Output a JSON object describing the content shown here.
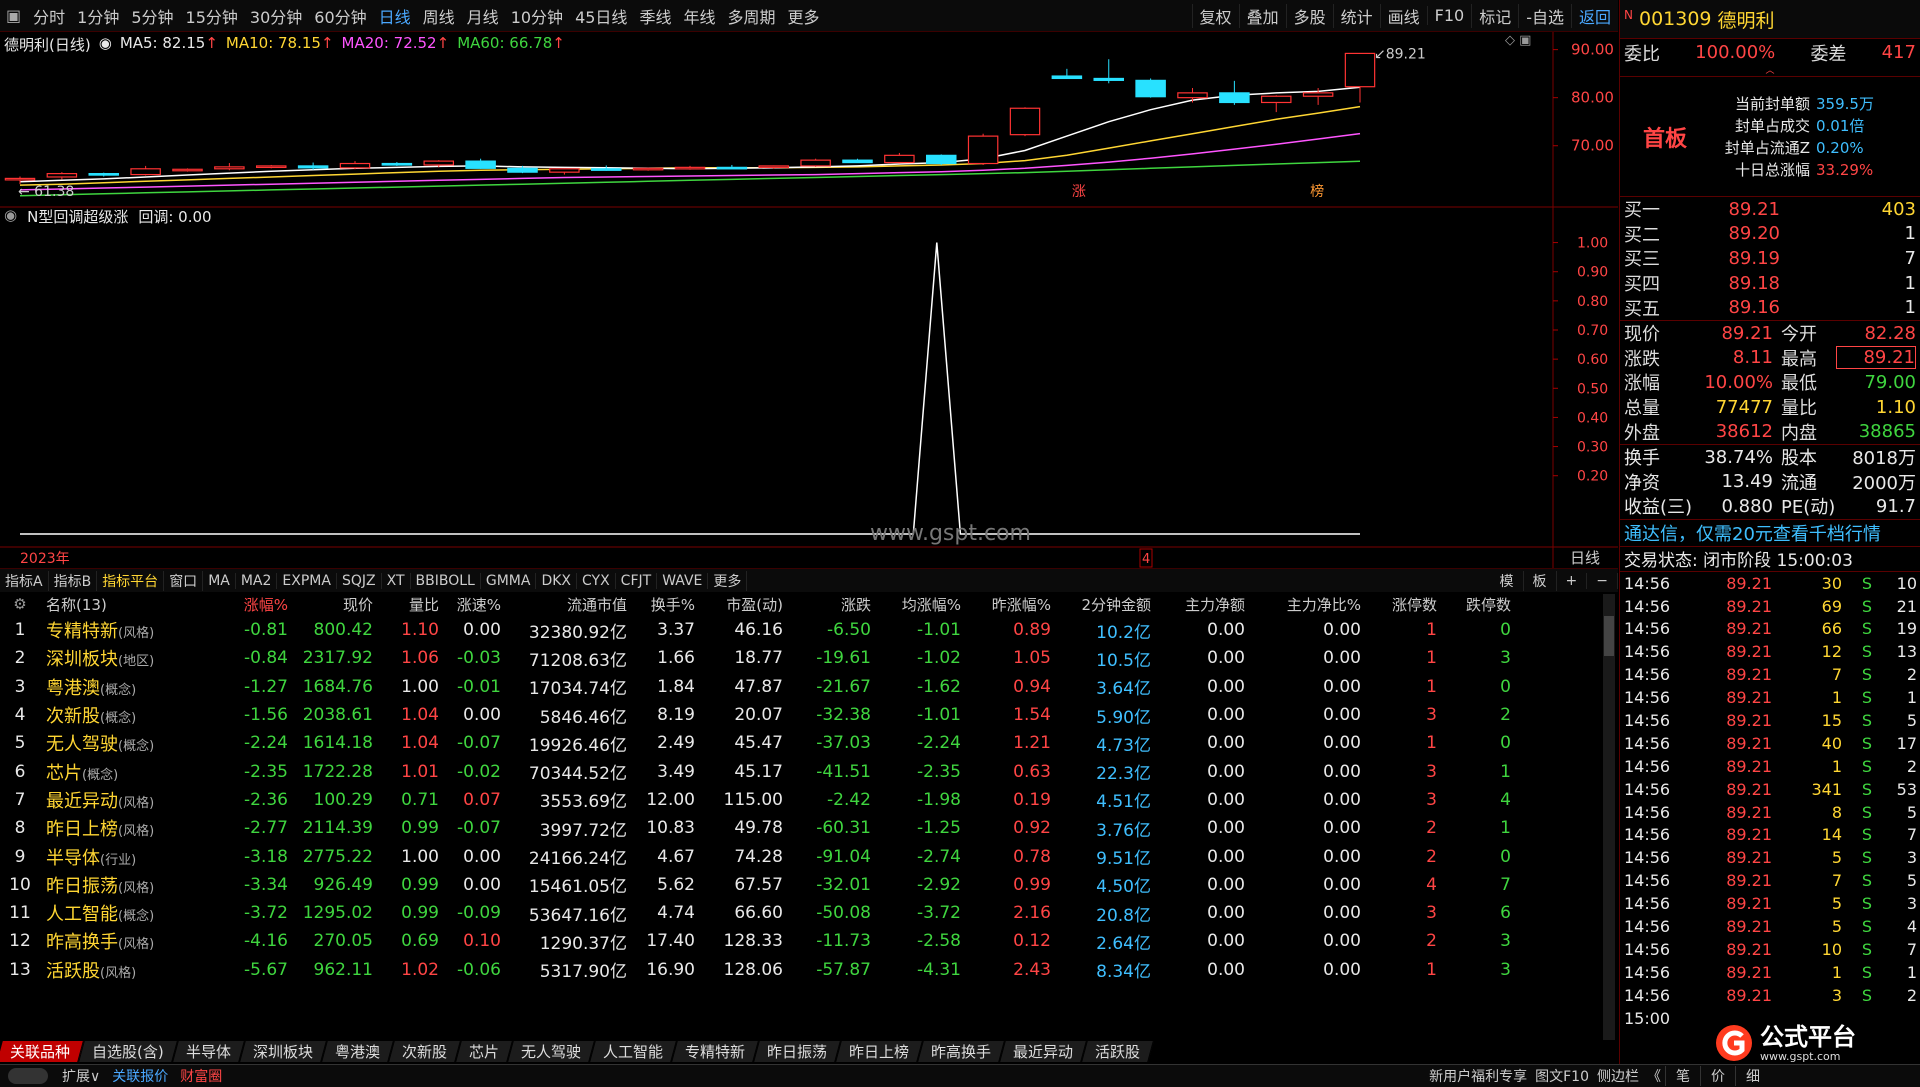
{
  "periods": [
    "分时",
    "1分钟",
    "5分钟",
    "15分钟",
    "30分钟",
    "60分钟",
    "日线",
    "周线",
    "月线",
    "10分钟",
    "45日线",
    "季线",
    "年线",
    "多周期",
    "更多"
  ],
  "active_period": "日线",
  "tools": [
    "复权",
    "叠加",
    "多股",
    "统计",
    "画线",
    "F10",
    "标记",
    "-自选",
    "返回"
  ],
  "kinfo": {
    "name": "德明利(日线)",
    "ma5": "MA5: 82.15",
    "ma10": "MA10: 78.15",
    "ma20": "MA20: 72.52",
    "ma60": "MA60: 66.78",
    "arrow": "↑"
  },
  "price_axis": [
    "90.00",
    "80.00",
    "70.00"
  ],
  "high_label": "89.21",
  "low_label": "61.38",
  "markers": {
    "zhang": "涨",
    "bang": "榜"
  },
  "indicator": {
    "title": "N型回调超级涨",
    "field": "回调: 0.00",
    "axis": [
      "1.00",
      "0.90",
      "0.80",
      "0.70",
      "0.60",
      "0.50",
      "0.40",
      "0.30",
      "0.20"
    ],
    "year": "2023年",
    "cursor_val": "4",
    "period_label": "日线",
    "watermark": "www.gspt.com"
  },
  "ind_tabs": [
    "指标A",
    "指标B",
    "指标平台",
    "窗口",
    "MA",
    "MA2",
    "EXPMA",
    "SQJZ",
    "XT",
    "BBIBOLL",
    "GMMA",
    "DKX",
    "CYX",
    "CFJT",
    "WAVE",
    "更多"
  ],
  "ind_tabs_active": "指标平台",
  "ind_tabs_right": [
    "模",
    "板",
    "+",
    "−"
  ],
  "table": {
    "headers": [
      "",
      "名称(13)",
      "涨幅%",
      "现价",
      "量比",
      "涨速%",
      "流通市值",
      "换手%",
      "市盈(动)",
      "涨跌",
      "均涨幅%",
      "昨涨幅%",
      "2分钟金额",
      "主力净额",
      "主力净比%",
      "涨停数",
      "跌停数"
    ],
    "rows": [
      [
        "1",
        "专精特新",
        "(风格)",
        "-0.81",
        "800.42",
        "1.10",
        "0.00",
        "32380.92亿",
        "3.37",
        "46.16",
        "-6.50",
        "-1.01",
        "0.89",
        "10.2亿",
        "0.00",
        "0.00",
        "1",
        "0"
      ],
      [
        "2",
        "深圳板块",
        "(地区)",
        "-0.84",
        "2317.92",
        "1.06",
        "-0.03",
        "71208.63亿",
        "1.66",
        "18.77",
        "-19.61",
        "-1.02",
        "1.05",
        "10.5亿",
        "0.00",
        "0.00",
        "1",
        "3"
      ],
      [
        "3",
        "粤港澳",
        "(概念)",
        "-1.27",
        "1684.76",
        "1.00",
        "-0.01",
        "17034.74亿",
        "1.84",
        "47.87",
        "-21.67",
        "-1.62",
        "0.94",
        "3.64亿",
        "0.00",
        "0.00",
        "1",
        "0"
      ],
      [
        "4",
        "次新股",
        "(概念)",
        "-1.56",
        "2038.61",
        "1.04",
        "0.00",
        "5846.46亿",
        "8.19",
        "20.07",
        "-32.38",
        "-1.01",
        "1.54",
        "5.90亿",
        "0.00",
        "0.00",
        "3",
        "2"
      ],
      [
        "5",
        "无人驾驶",
        "(概念)",
        "-2.24",
        "1614.18",
        "1.04",
        "-0.07",
        "19926.46亿",
        "2.49",
        "45.47",
        "-37.03",
        "-2.24",
        "1.21",
        "4.73亿",
        "0.00",
        "0.00",
        "1",
        "0"
      ],
      [
        "6",
        "芯片",
        "(概念)",
        "-2.35",
        "1722.28",
        "1.01",
        "-0.02",
        "70344.52亿",
        "3.49",
        "45.17",
        "-41.51",
        "-2.35",
        "0.63",
        "22.3亿",
        "0.00",
        "0.00",
        "3",
        "1"
      ],
      [
        "7",
        "最近异动",
        "(风格)",
        "-2.36",
        "100.29",
        "0.71",
        "0.07",
        "3553.69亿",
        "12.00",
        "115.00",
        "-2.42",
        "-1.98",
        "0.19",
        "4.51亿",
        "0.00",
        "0.00",
        "3",
        "4"
      ],
      [
        "8",
        "昨日上榜",
        "(风格)",
        "-2.77",
        "2114.39",
        "0.99",
        "-0.07",
        "3997.72亿",
        "10.83",
        "49.78",
        "-60.31",
        "-1.25",
        "0.92",
        "3.76亿",
        "0.00",
        "0.00",
        "2",
        "1"
      ],
      [
        "9",
        "半导体",
        "(行业)",
        "-3.18",
        "2775.22",
        "1.00",
        "0.00",
        "24166.24亿",
        "4.67",
        "74.28",
        "-91.04",
        "-2.74",
        "0.78",
        "9.51亿",
        "0.00",
        "0.00",
        "2",
        "0"
      ],
      [
        "10",
        "昨日振荡",
        "(风格)",
        "-3.34",
        "926.49",
        "0.99",
        "0.00",
        "15461.05亿",
        "5.62",
        "67.57",
        "-32.01",
        "-2.92",
        "0.99",
        "4.50亿",
        "0.00",
        "0.00",
        "4",
        "7"
      ],
      [
        "11",
        "人工智能",
        "(概念)",
        "-3.72",
        "1295.02",
        "0.99",
        "-0.09",
        "53647.16亿",
        "4.74",
        "66.60",
        "-50.08",
        "-3.72",
        "2.16",
        "20.8亿",
        "0.00",
        "0.00",
        "3",
        "6"
      ],
      [
        "12",
        "昨高换手",
        "(风格)",
        "-4.16",
        "270.05",
        "0.69",
        "0.10",
        "1290.37亿",
        "17.40",
        "128.33",
        "-11.73",
        "-2.58",
        "0.12",
        "2.64亿",
        "0.00",
        "0.00",
        "2",
        "3"
      ],
      [
        "13",
        "活跃股",
        "(风格)",
        "-5.67",
        "962.11",
        "1.02",
        "-0.06",
        "5317.90亿",
        "16.90",
        "128.06",
        "-57.87",
        "-4.31",
        "2.43",
        "8.34亿",
        "0.00",
        "0.00",
        "1",
        "3"
      ]
    ]
  },
  "sectors": [
    "关联品种",
    "自选股(含)",
    "半导体",
    "深圳板块",
    "粤港澳",
    "次新股",
    "芯片",
    "无人驾驶",
    "人工智能",
    "专精特新",
    "昨日振荡",
    "昨日上榜",
    "昨高换手",
    "最近异动",
    "活跃股"
  ],
  "bottom": {
    "left": [
      "扩展∨",
      "关联报价",
      "财富圈"
    ],
    "right": [
      "新用户福利专享",
      "图文F10",
      "侧边栏",
      "《"
    ],
    "tabs": [
      "笔",
      "价",
      "细"
    ]
  },
  "stock": {
    "tag": "N",
    "code": "001309",
    "name": "德明利"
  },
  "weibi": {
    "label1": "委比",
    "val1": "100.00%",
    "label2": "委差",
    "val2": "417"
  },
  "board": {
    "label": "首板",
    "items": [
      [
        "当前封单额",
        "359.5万"
      ],
      [
        "封单占成交",
        "0.01倍"
      ],
      [
        "封单占流通Z",
        "0.20%"
      ],
      [
        "十日总涨幅",
        "33.29%"
      ]
    ]
  },
  "bids": [
    [
      "买一",
      "89.21",
      "403"
    ],
    [
      "买二",
      "89.20",
      "1"
    ],
    [
      "买三",
      "89.19",
      "7"
    ],
    [
      "买四",
      "89.18",
      "1"
    ],
    [
      "买五",
      "89.16",
      "1"
    ]
  ],
  "quote": [
    [
      "现价",
      "89.21",
      "今开",
      "82.28"
    ],
    [
      "涨跌",
      "8.11",
      "最高",
      "89.21"
    ],
    [
      "涨幅",
      "10.00%",
      "最低",
      "79.00"
    ],
    [
      "总量",
      "77477",
      "量比",
      "1.10"
    ],
    [
      "外盘",
      "38612",
      "内盘",
      "38865"
    ]
  ],
  "fundamentals": [
    [
      "换手",
      "38.74%",
      "股本",
      "8018万"
    ],
    [
      "净资",
      "13.49",
      "流通",
      "2000万"
    ],
    [
      "收益(三)",
      "0.880",
      "PE(动)",
      "91.7"
    ]
  ],
  "promo": "通达信，仅需20元查看千档行情",
  "trade_status": "交易状态: 闭市阶段 15:00:03",
  "ticks": [
    [
      "14:56",
      "89.21",
      "30",
      "S",
      "10"
    ],
    [
      "14:56",
      "89.21",
      "69",
      "S",
      "21"
    ],
    [
      "14:56",
      "89.21",
      "66",
      "S",
      "19"
    ],
    [
      "14:56",
      "89.21",
      "12",
      "S",
      "13"
    ],
    [
      "14:56",
      "89.21",
      "7",
      "S",
      "2"
    ],
    [
      "14:56",
      "89.21",
      "1",
      "S",
      "1"
    ],
    [
      "14:56",
      "89.21",
      "15",
      "S",
      "5"
    ],
    [
      "14:56",
      "89.21",
      "40",
      "S",
      "17"
    ],
    [
      "14:56",
      "89.21",
      "1",
      "S",
      "2"
    ],
    [
      "14:56",
      "89.21",
      "341",
      "S",
      "53"
    ],
    [
      "14:56",
      "89.21",
      "8",
      "S",
      "5"
    ],
    [
      "14:56",
      "89.21",
      "14",
      "S",
      "7"
    ],
    [
      "14:56",
      "89.21",
      "5",
      "S",
      "3"
    ],
    [
      "14:56",
      "89.21",
      "7",
      "S",
      "5"
    ],
    [
      "14:56",
      "89.21",
      "5",
      "S",
      "3"
    ],
    [
      "14:56",
      "89.21",
      "5",
      "S",
      "4"
    ],
    [
      "14:56",
      "89.21",
      "10",
      "S",
      "7"
    ],
    [
      "14:56",
      "89.21",
      "1",
      "S",
      "1"
    ],
    [
      "14:56",
      "89.21",
      "3",
      "S",
      "2"
    ],
    [
      "15:00",
      "",
      "",
      "",
      ""
    ]
  ],
  "logo": {
    "text": "公式平台",
    "url": "www.gspt.com"
  },
  "colors": {
    "up": "#ff4545",
    "down": "#3fd53f",
    "frame": "#5a0000",
    "accent": "#4aa8ff"
  },
  "chart_data": {
    "type": "candlestick",
    "candles": [
      [
        63.0,
        63.6,
        62.0,
        63.2
      ],
      [
        63.5,
        64.5,
        63.0,
        64.2
      ],
      [
        64.2,
        64.4,
        63.6,
        64.0
      ],
      [
        64.0,
        65.8,
        63.8,
        65.2
      ],
      [
        65.0,
        65.3,
        64.6,
        65.1
      ],
      [
        65.2,
        66.4,
        64.9,
        65.6
      ],
      [
        65.6,
        66.0,
        65.3,
        65.8
      ],
      [
        65.8,
        66.5,
        65.0,
        65.4
      ],
      [
        65.4,
        66.8,
        65.1,
        66.3
      ],
      [
        66.3,
        66.6,
        65.8,
        66.0
      ],
      [
        66.0,
        67.0,
        65.5,
        66.8
      ],
      [
        66.8,
        67.3,
        65.2,
        65.3
      ],
      [
        65.3,
        65.8,
        64.3,
        64.5
      ],
      [
        64.5,
        65.3,
        64.0,
        65.2
      ],
      [
        65.2,
        65.9,
        64.8,
        65.1
      ],
      [
        65.1,
        65.4,
        64.8,
        65.3
      ],
      [
        65.3,
        65.8,
        65.0,
        65.5
      ],
      [
        65.5,
        66.0,
        65.2,
        65.4
      ],
      [
        65.6,
        65.9,
        65.2,
        65.8
      ],
      [
        65.8,
        67.3,
        65.6,
        67.0
      ],
      [
        67.0,
        67.3,
        66.4,
        66.5
      ],
      [
        66.5,
        68.5,
        66.3,
        68.0
      ],
      [
        68.0,
        68.2,
        66.0,
        66.3
      ],
      [
        66.3,
        72.5,
        66.0,
        72.0
      ],
      [
        72.3,
        78.0,
        72.0,
        77.8
      ],
      [
        84.5,
        86.0,
        84.0,
        84.0
      ],
      [
        84.0,
        88.0,
        83.0,
        83.6
      ],
      [
        83.6,
        84.0,
        80.0,
        80.2
      ],
      [
        80.0,
        82.0,
        79.0,
        81.0
      ],
      [
        81.0,
        83.5,
        78.5,
        79.0
      ],
      [
        79.0,
        80.5,
        77.0,
        80.3
      ],
      [
        80.3,
        82.0,
        78.5,
        81.0
      ],
      [
        82.28,
        89.21,
        79.0,
        89.21
      ]
    ],
    "ma5": [
      62.5,
      62.8,
      63.1,
      63.5,
      63.9,
      64.3,
      64.7,
      65.0,
      65.3,
      65.5,
      65.7,
      65.8,
      65.6,
      65.5,
      65.4,
      65.3,
      65.2,
      65.3,
      65.4,
      65.6,
      65.8,
      66.2,
      66.5,
      67.3,
      69.0,
      72.0,
      75.0,
      77.5,
      79.5,
      80.5,
      81.0,
      81.3,
      82.15
    ],
    "ma10": [
      61.8,
      62.0,
      62.3,
      62.6,
      62.9,
      63.2,
      63.5,
      63.8,
      64.1,
      64.4,
      64.7,
      64.9,
      65.0,
      65.1,
      65.2,
      65.3,
      65.4,
      65.4,
      65.4,
      65.5,
      65.6,
      65.8,
      66.0,
      66.3,
      66.9,
      68.0,
      69.5,
      71.0,
      72.5,
      74.0,
      75.5,
      76.8,
      78.15
    ],
    "ma20": [
      60.8,
      61.0,
      61.2,
      61.4,
      61.6,
      61.8,
      62.0,
      62.2,
      62.4,
      62.6,
      62.8,
      63.0,
      63.2,
      63.4,
      63.5,
      63.6,
      63.7,
      63.8,
      63.9,
      64.0,
      64.2,
      64.4,
      64.6,
      64.9,
      65.3,
      65.9,
      66.6,
      67.4,
      68.3,
      69.3,
      70.3,
      71.4,
      72.52
    ],
    "ma60": [
      59.6,
      59.8,
      60.0,
      60.2,
      60.4,
      60.6,
      60.8,
      61.0,
      61.2,
      61.4,
      61.6,
      61.8,
      62.0,
      62.2,
      62.4,
      62.6,
      62.8,
      63.0,
      63.2,
      63.4,
      63.6,
      63.8,
      64.0,
      64.2,
      64.4,
      64.7,
      65.0,
      65.3,
      65.6,
      65.9,
      66.2,
      66.5,
      66.78
    ],
    "ylim": [
      58.5,
      92.0
    ],
    "indicator_series": [
      0,
      0,
      0,
      0,
      0,
      0,
      0,
      0,
      0,
      0,
      0,
      0,
      0,
      0,
      0,
      0,
      0,
      0,
      0,
      0,
      0,
      0,
      0,
      0,
      0,
      0,
      0,
      0,
      0,
      0,
      0,
      0,
      0,
      0,
      0,
      0,
      0,
      0,
      0,
      1,
      0,
      0,
      0,
      0,
      0,
      0,
      0,
      0,
      0,
      0,
      0,
      0,
      0,
      0,
      0,
      0,
      0,
      0
    ],
    "indicator_ylim": [
      0,
      1.05
    ]
  }
}
